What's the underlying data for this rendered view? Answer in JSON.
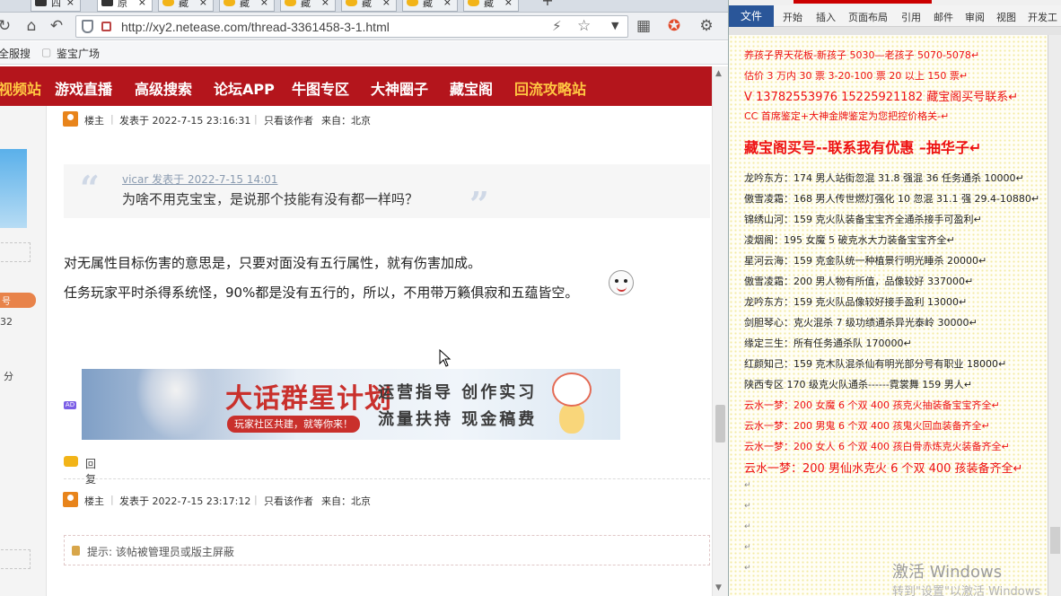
{
  "browser": {
    "tabs": [
      {
        "label": "四",
        "icon": "dark"
      },
      {
        "label": "原",
        "icon": "dark"
      },
      {
        "label": "藏",
        "icon": "yellow"
      },
      {
        "label": "藏",
        "icon": "yellow"
      },
      {
        "label": "藏",
        "icon": "yellow"
      },
      {
        "label": "藏",
        "icon": "yellow"
      },
      {
        "label": "藏",
        "icon": "yellow"
      }
    ],
    "tab_close": "×",
    "new_tab": "+",
    "url": "http://xy2.netease.com/thread-3361458-3-1.html",
    "bookmarks": [
      "全服搜",
      "鉴宝广场"
    ]
  },
  "site_nav": [
    "视频站",
    "游戏直播",
    "高级搜索",
    "论坛APP",
    "牛图专区",
    "大神圈子",
    "藏宝阁",
    "回流攻略站"
  ],
  "left_column": {
    "tag": "号",
    "num": "32",
    "char": "分"
  },
  "post1": {
    "role": "楼主",
    "time": "发表于 2022-7-15 23:16:31",
    "only_author": "只看该作者",
    "from": "来自：北京",
    "quote_author": "vicar 发表于 2022-7-15 14:01",
    "quote_text": "为啥不用克宝宝，是说那个技能有没有都一样吗？",
    "line1": "对无属性目标伤害的意思是，只要对面没有五行属性，就有伤害加成。",
    "line2": "任务玩家平时杀得系统怪，90%都是没有五行的，所以，不用带万籁俱寂和五蕴皆空。",
    "reply": "回复"
  },
  "banner": {
    "title": "大话群星计划",
    "subtitle": "玩家社区共建，就等你来！",
    "r1": "运营指导 创作实习",
    "r2": "流量扶持 现金稿费",
    "ad": "AD"
  },
  "post2": {
    "role": "楼主",
    "time": "发表于 2022-7-15 23:17:12",
    "only_author": "只看该作者",
    "from": "来自：北京",
    "notice": "提示: 该帖被管理员或版主屏蔽"
  },
  "word": {
    "file_tab": "文件",
    "tabs": [
      "开始",
      "插入",
      "页面布局",
      "引用",
      "邮件",
      "审阅",
      "视图",
      "开发工"
    ],
    "lines": [
      {
        "text": "养孩子界天花板-新孩子 5030—老孩子 5070-5078↵",
        "style": "red"
      },
      {
        "text": "估价 3 万内 30 票    3-20-100 票      20 以上 150 票↵",
        "style": "red"
      },
      {
        "text": "V 13782553976    15225921182  藏宝阁买号联系↵",
        "style": "red big"
      },
      {
        "text": "CC 首席鉴定+大神金牌鉴定为您把控价格关-↵",
        "style": "red"
      },
      {
        "text": "藏宝阁买号--联系我有优惠 –抽华子↵",
        "style": "hdr"
      },
      {
        "text": "龙吟东方：174 男人站街忽混 31.8 强混 36 任务通杀 10000↵",
        "style": ""
      },
      {
        "text": "傲雪凌霜：168 男人传世燃灯强化 10 忽混 31.1 强 29.4-10880↵",
        "style": ""
      },
      {
        "text": "锦绣山河：159 克火队装备宝宝齐全通杀接手可盈利↵",
        "style": ""
      },
      {
        "text": "凌烟阁：195 女魔 5 破克水大力装备宝宝齐全↵",
        "style": ""
      },
      {
        "text": "星河云海：159 克金队统一种植景行明光睡杀 20000↵",
        "style": ""
      },
      {
        "text": "傲雪凌霜：200 男人物有所值，品像较好 337000↵",
        "style": ""
      },
      {
        "text": "龙吟东方：159 克火队品像较好接手盈利 13000↵",
        "style": ""
      },
      {
        "text": "剑胆琴心：克火混杀 7 级功绩通杀异光泰岭 30000↵",
        "style": ""
      },
      {
        "text": "缘定三生：所有任务通杀队 170000↵",
        "style": ""
      },
      {
        "text": "红颜知己：159 克木队混杀仙有明光部分号有职业 18000↵",
        "style": ""
      },
      {
        "text": "陕西专区 170 级克火队通杀------霓裳舞 159 男人↵",
        "style": ""
      },
      {
        "text": "云水一梦：200 女魔 6 个双 400 孩克火抽装备宝宝齐全↵",
        "style": "red"
      },
      {
        "text": "云水一梦：200 男鬼 6 个双 400 孩鬼火回血装备齐全↵",
        "style": "red"
      },
      {
        "text": "云水一梦：200 女人 6 个双 400 孩白骨赤炼克火装备齐全↵",
        "style": "red"
      },
      {
        "text": "云水一梦：200 男仙水克火 6 个双 400 孩装备齐全↵",
        "style": "red big"
      }
    ],
    "empty_marks": [
      "↵",
      "↵",
      "↵",
      "↵",
      "↵"
    ],
    "watermark1": "激活 Windows",
    "watermark2": "转到\"设置\"以激活 Windows"
  }
}
